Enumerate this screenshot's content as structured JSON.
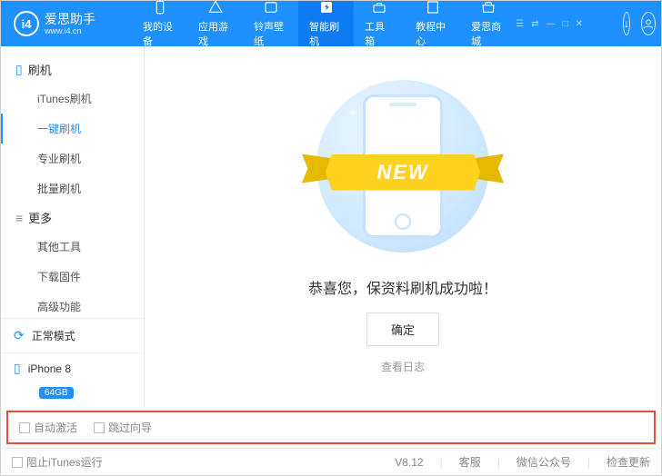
{
  "header": {
    "logo_text": "i4",
    "brand": "爱思助手",
    "site": "www.i4.cn",
    "nav": [
      {
        "label": "我的设备"
      },
      {
        "label": "应用游戏"
      },
      {
        "label": "铃声壁纸"
      },
      {
        "label": "智能刷机"
      },
      {
        "label": "工具箱"
      },
      {
        "label": "教程中心"
      },
      {
        "label": "爱思商城"
      }
    ]
  },
  "sidebar": {
    "section1_title": "刷机",
    "items1": [
      {
        "label": "iTunes刷机"
      },
      {
        "label": "一键刷机"
      },
      {
        "label": "专业刷机"
      },
      {
        "label": "批量刷机"
      }
    ],
    "section2_title": "更多",
    "items2": [
      {
        "label": "其他工具"
      },
      {
        "label": "下载固件"
      },
      {
        "label": "高级功能"
      }
    ],
    "mode": "正常模式",
    "device": "iPhone 8",
    "storage": "64GB"
  },
  "content": {
    "ribbon": "NEW",
    "success": "恭喜您，保资料刷机成功啦！",
    "ok": "确定",
    "log": "查看日志"
  },
  "footer": {
    "auto_activate": "自动激活",
    "skip_guide": "跳过向导",
    "block_itunes": "阻止iTunes运行",
    "version": "V8.12",
    "link1": "客服",
    "link2": "微信公众号",
    "link3": "检查更新"
  }
}
